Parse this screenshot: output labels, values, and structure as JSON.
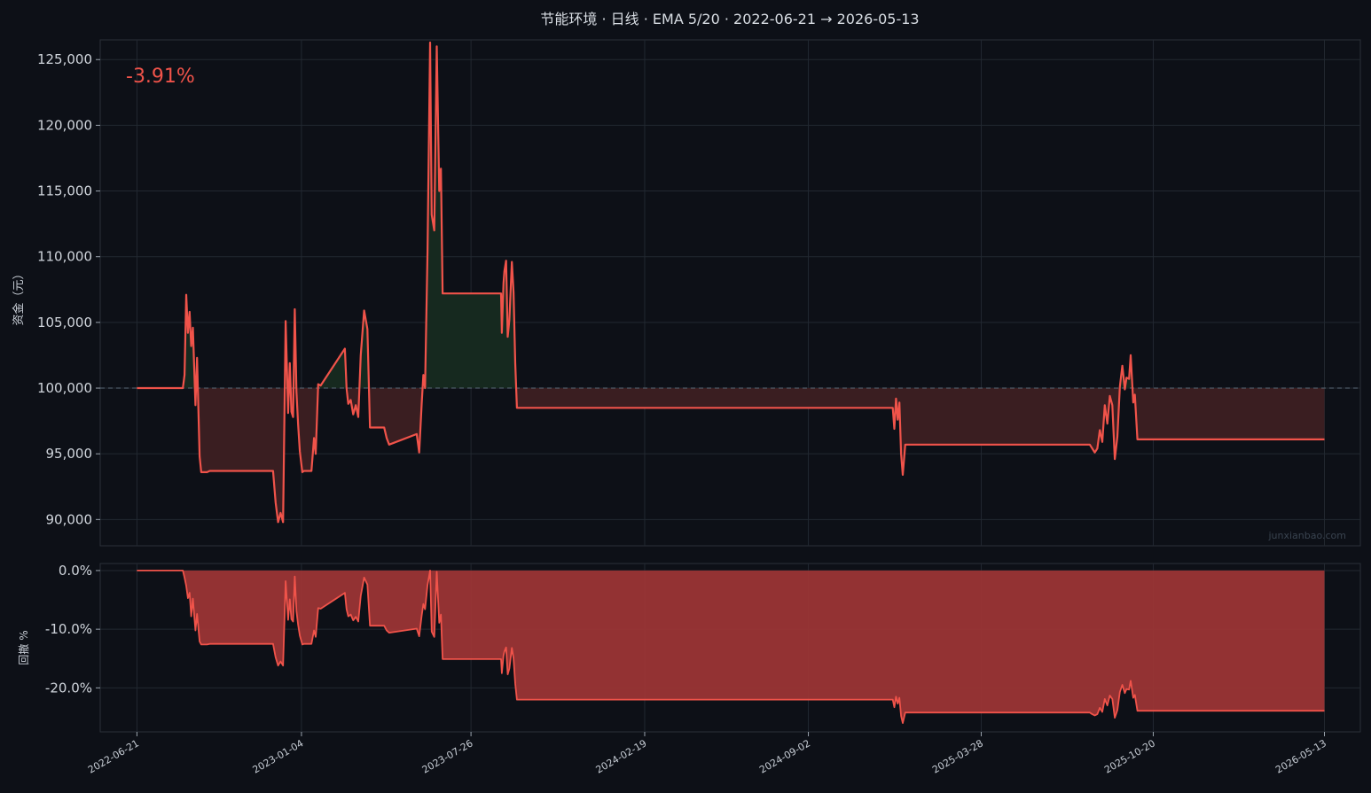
{
  "chart_data": [
    {
      "type": "area",
      "title": "节能环境 · 日线 · EMA 5/20 · 2022-06-21 → 2026-05-13",
      "ylabel": "资金（元）",
      "annotation": "-3.91%",
      "watermark": "junxianbao.com",
      "baseline": 100000,
      "ylim": [
        88000,
        126500
      ],
      "yticks": [
        90000,
        95000,
        100000,
        105000,
        110000,
        115000,
        120000,
        125000
      ],
      "ytick_labels": [
        "90,000",
        "95,000",
        "100,000",
        "105,000",
        "110,000",
        "115,000",
        "120,000",
        "125,000"
      ],
      "xlim": [
        "2022-05-08",
        "2026-06-25"
      ],
      "xticks": [
        "2022-06-21",
        "2023-01-04",
        "2023-07-26",
        "2024-02-19",
        "2024-09-02",
        "2025-03-28",
        "2025-10-20",
        "2026-05-13"
      ],
      "colors": {
        "line": "#f0534a",
        "gain_fill": "#16291f",
        "loss_fill": "#3a1e21",
        "baseline": "#5a6a78"
      },
      "series": [
        {
          "x": [
            "2022-06-21",
            "2022-08-15",
            "2022-08-17",
            "2022-08-19",
            "2022-08-21",
            "2022-08-23",
            "2022-08-25",
            "2022-08-27",
            "2022-08-30",
            "2022-09-01",
            "2022-09-04",
            "2022-09-06",
            "2022-09-08",
            "2022-09-11",
            "2022-09-13",
            "2022-09-16",
            "2022-12-01",
            "2022-12-04",
            "2022-12-07",
            "2022-12-10",
            "2022-12-13",
            "2022-12-16",
            "2022-12-19",
            "2022-12-21",
            "2022-12-23",
            "2022-12-25",
            "2022-12-27",
            "2022-12-29",
            "2022-12-31",
            "2023-01-02",
            "2023-01-05",
            "2023-01-07",
            "2023-01-09",
            "2023-01-11",
            "2023-01-13",
            "2023-01-16",
            "2023-01-19",
            "2023-01-21",
            "2023-01-24",
            "2023-01-27",
            "2023-02-25",
            "2023-02-27",
            "2023-03-01",
            "2023-03-04",
            "2023-03-07",
            "2023-03-10",
            "2023-03-13",
            "2023-03-16",
            "2023-03-20",
            "2023-03-24",
            "2023-03-27",
            "2023-03-30",
            "2023-04-02",
            "2023-04-05",
            "2023-04-08",
            "2023-04-11",
            "2023-04-13",
            "2023-04-16",
            "2023-04-19",
            "2023-05-22",
            "2023-05-25",
            "2023-05-28",
            "2023-05-30",
            "2023-06-01",
            "2023-06-04",
            "2023-06-07",
            "2023-06-09",
            "2023-06-12",
            "2023-06-15",
            "2023-06-18",
            "2023-06-20",
            "2023-06-22",
            "2023-06-24",
            "2023-06-26",
            "2023-06-29",
            "2023-07-01",
            "2023-07-03",
            "2023-07-05",
            "2023-07-08",
            "2023-07-10",
            "2023-08-31",
            "2023-09-01",
            "2023-09-03",
            "2023-09-04",
            "2023-09-06",
            "2023-09-08",
            "2023-09-10",
            "2023-09-13",
            "2023-09-15",
            "2023-09-17",
            "2023-09-19",
            "2023-09-21",
            "2023-09-24",
            "2023-09-26",
            "2024-12-12",
            "2024-12-14",
            "2024-12-16",
            "2024-12-18",
            "2024-12-20",
            "2024-12-22",
            "2024-12-24",
            "2024-12-27",
            "2024-12-30",
            "2025-01-02",
            "2025-08-05",
            "2025-08-08",
            "2025-08-11",
            "2025-08-14",
            "2025-08-17",
            "2025-08-20",
            "2025-08-23",
            "2025-08-26",
            "2025-08-29",
            "2025-09-01",
            "2025-09-04",
            "2025-09-07",
            "2025-09-10",
            "2025-09-13",
            "2025-09-16",
            "2025-09-18",
            "2025-09-21",
            "2025-09-23",
            "2025-09-26",
            "2025-09-28",
            "2025-10-01",
            "2025-10-03",
            "2025-10-06",
            "2025-10-09",
            "2026-05-13"
          ],
          "y": [
            100000,
            100000,
            101000,
            107100,
            104200,
            105800,
            103200,
            104600,
            98700,
            102300,
            94800,
            93600,
            93600,
            93600,
            93600,
            93700,
            93700,
            91300,
            89800,
            90500,
            89800,
            105100,
            98100,
            101900,
            98200,
            97800,
            106000,
            99700,
            97200,
            95200,
            93600,
            93700,
            93700,
            93700,
            93700,
            93700,
            96200,
            95000,
            100300,
            100200,
            103000,
            100000,
            98800,
            99100,
            98000,
            98700,
            97800,
            102500,
            105900,
            104500,
            97000,
            97000,
            97000,
            97000,
            97000,
            97000,
            97000,
            96200,
            95700,
            96500,
            95100,
            98800,
            101000,
            100000,
            110400,
            126300,
            113200,
            112000,
            126000,
            115000,
            116700,
            107200,
            107200,
            107200,
            107200,
            107200,
            107200,
            107200,
            107200,
            107200,
            107200,
            104200,
            108000,
            108900,
            109700,
            103900,
            105200,
            109600,
            107300,
            101900,
            98500,
            98500,
            98500,
            98500,
            98500,
            96900,
            99200,
            97600,
            98900,
            95000,
            93400,
            95700,
            95700,
            95700,
            95700,
            95400,
            95100,
            95400,
            96800,
            95900,
            98700,
            97300,
            99400,
            98700,
            94600,
            96300,
            100100,
            101700,
            99900,
            100800,
            100700,
            102500,
            98900,
            99500,
            96100,
            96100,
            96100,
            96100,
            96100
          ]
        }
      ]
    },
    {
      "type": "area",
      "ylabel": "回撤 %",
      "ylim": [
        -27.5,
        1.2
      ],
      "yticks": [
        0,
        -10,
        -20
      ],
      "ytick_labels": [
        "0.0%",
        "-10.0%",
        "-20.0%"
      ],
      "xlim": [
        "2022-05-08",
        "2026-06-25"
      ],
      "xticks": [
        "2022-06-21",
        "2023-01-04",
        "2023-07-26",
        "2024-02-19",
        "2024-09-02",
        "2025-03-28",
        "2025-10-20",
        "2026-05-13"
      ],
      "colors": {
        "line": "#f0534a",
        "fill": "#9b3535"
      },
      "series": [
        {
          "x": [
            "2022-06-21",
            "2022-08-15",
            "2022-08-17",
            "2022-08-19",
            "2022-08-21",
            "2022-08-23",
            "2022-08-25",
            "2022-08-27",
            "2022-08-30",
            "2022-09-01",
            "2022-09-04",
            "2022-09-06",
            "2022-09-08",
            "2022-09-11",
            "2022-09-13",
            "2022-09-16",
            "2022-12-01",
            "2022-12-04",
            "2022-12-07",
            "2022-12-10",
            "2022-12-13",
            "2022-12-16",
            "2022-12-19",
            "2022-12-21",
            "2022-12-23",
            "2022-12-25",
            "2022-12-27",
            "2022-12-29",
            "2022-12-31",
            "2023-01-02",
            "2023-01-05",
            "2023-01-07",
            "2023-01-09",
            "2023-01-11",
            "2023-01-13",
            "2023-01-16",
            "2023-01-19",
            "2023-01-21",
            "2023-01-24",
            "2023-01-27",
            "2023-02-25",
            "2023-02-27",
            "2023-03-01",
            "2023-03-04",
            "2023-03-07",
            "2023-03-10",
            "2023-03-13",
            "2023-03-16",
            "2023-03-20",
            "2023-03-24",
            "2023-03-27",
            "2023-03-30",
            "2023-04-02",
            "2023-04-05",
            "2023-04-08",
            "2023-04-11",
            "2023-04-13",
            "2023-04-16",
            "2023-04-19",
            "2023-05-22",
            "2023-05-25",
            "2023-05-28",
            "2023-05-30",
            "2023-06-01",
            "2023-06-04",
            "2023-06-07",
            "2023-06-09",
            "2023-06-12",
            "2023-06-15",
            "2023-06-18",
            "2023-06-20",
            "2023-06-22",
            "2023-06-24",
            "2023-06-26",
            "2023-06-29",
            "2023-07-01",
            "2023-07-03",
            "2023-07-05",
            "2023-07-08",
            "2023-07-10",
            "2023-08-31",
            "2023-09-01",
            "2023-09-03",
            "2023-09-04",
            "2023-09-06",
            "2023-09-08",
            "2023-09-10",
            "2023-09-13",
            "2023-09-15",
            "2023-09-17",
            "2023-09-19",
            "2023-09-21",
            "2023-09-24",
            "2023-09-26",
            "2024-12-12",
            "2024-12-14",
            "2024-12-16",
            "2024-12-18",
            "2024-12-20",
            "2024-12-22",
            "2024-12-24",
            "2024-12-27",
            "2024-12-30",
            "2025-01-02",
            "2025-08-05",
            "2025-08-08",
            "2025-08-11",
            "2025-08-14",
            "2025-08-17",
            "2025-08-20",
            "2025-08-23",
            "2025-08-26",
            "2025-08-29",
            "2025-09-01",
            "2025-09-04",
            "2025-09-07",
            "2025-09-10",
            "2025-09-13",
            "2025-09-16",
            "2025-09-18",
            "2025-09-21",
            "2025-09-23",
            "2025-09-26",
            "2025-09-28",
            "2025-10-01",
            "2025-10-03",
            "2025-10-06",
            "2025-10-09",
            "2026-05-13"
          ],
          "y": [
            0,
            0,
            -1.2,
            -2.6,
            -4.7,
            -3.8,
            -7.8,
            -4.8,
            -10.2,
            -7.4,
            -12.1,
            -12.6,
            -12.6,
            -12.6,
            -12.6,
            -12.5,
            -12.5,
            -14.8,
            -16.2,
            -15.5,
            -16.2,
            -1.8,
            -8.4,
            -4.9,
            -8.3,
            -8.7,
            -1.0,
            -6.9,
            -9.3,
            -11.1,
            -12.6,
            -12.5,
            -12.5,
            -12.5,
            -12.5,
            -12.5,
            -10.2,
            -11.3,
            -6.4,
            -6.5,
            -3.8,
            -6.6,
            -7.8,
            -7.5,
            -8.5,
            -7.9,
            -8.7,
            -4.3,
            -1.2,
            -2.4,
            -9.4,
            -9.4,
            -9.4,
            -9.4,
            -9.4,
            -9.4,
            -9.4,
            -10.2,
            -10.6,
            -9.9,
            -11.2,
            -7.7,
            -5.7,
            -6.6,
            -2.5,
            0,
            -10.4,
            -11.3,
            -0.2,
            -8.9,
            -7.5,
            -15.1,
            -15.1,
            -15.1,
            -15.1,
            -15.1,
            -15.1,
            -15.1,
            -15.1,
            -15.1,
            -15.1,
            -17.5,
            -14.5,
            -13.8,
            -13.1,
            -17.7,
            -16.7,
            -13.2,
            -15.0,
            -19.3,
            -22.0,
            -22.0,
            -22.0,
            -22.0,
            -22.0,
            -23.3,
            -21.5,
            -22.7,
            -21.7,
            -24.8,
            -26.0,
            -24.2,
            -24.2,
            -24.2,
            -24.2,
            -24.5,
            -24.7,
            -24.5,
            -23.4,
            -24.1,
            -21.9,
            -23.0,
            -21.3,
            -21.9,
            -25.1,
            -23.8,
            -20.7,
            -19.5,
            -20.9,
            -20.2,
            -20.3,
            -18.8,
            -21.7,
            -21.2,
            -23.9,
            -23.9,
            -23.9,
            -23.9,
            -23.9
          ]
        }
      ]
    }
  ]
}
